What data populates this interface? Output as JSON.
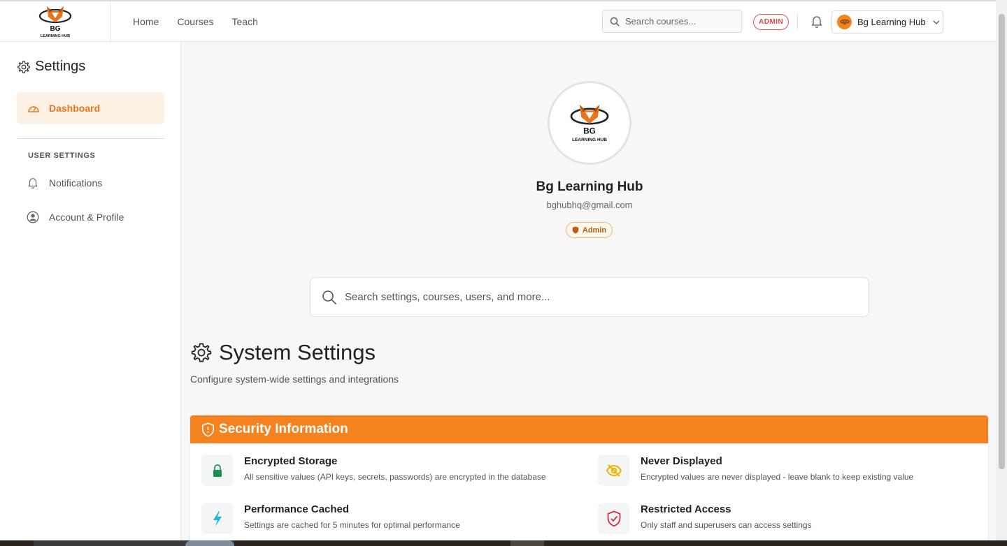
{
  "brand": {
    "logo_text_top": "BG",
    "logo_text_bottom": "LEARNING HUB"
  },
  "nav": {
    "links": [
      "Home",
      "Courses",
      "Teach"
    ]
  },
  "header": {
    "search_placeholder": "Search courses...",
    "admin_badge": "ADMIN",
    "user_name": "Bg Learning Hub"
  },
  "sidebar": {
    "title": "Settings",
    "active_item": "Dashboard",
    "section_label": "USER SETTINGS",
    "items": [
      "Notifications",
      "Account & Profile"
    ]
  },
  "profile": {
    "name": "Bg Learning Hub",
    "email": "bghubhq@gmail.com",
    "role": "Admin"
  },
  "main_search": {
    "placeholder": "Search settings, courses, users, and more..."
  },
  "system": {
    "title": "System Settings",
    "subtitle": "Configure system-wide settings and integrations"
  },
  "security": {
    "header": "Security Information",
    "features": [
      {
        "title": "Encrypted Storage",
        "desc": "All sensitive values (API keys, secrets, passwords) are encrypted in the database",
        "icon": "lock-icon"
      },
      {
        "title": "Never Displayed",
        "desc": "Encrypted values are never displayed - leave blank to keep existing value",
        "icon": "eye-off-icon"
      },
      {
        "title": "Performance Cached",
        "desc": "Settings are cached for 5 minutes for optimal performance",
        "icon": "lightning-icon"
      },
      {
        "title": "Restricted Access",
        "desc": "Only staff and superusers can access settings",
        "icon": "shield-check-icon"
      }
    ]
  },
  "colors": {
    "accent": "#f3821f",
    "admin_red": "#e04848",
    "lock_green": "#1f8f4e",
    "bolt_cyan": "#1fb4e6",
    "eye_yellow": "#f0b400",
    "shield_red": "#d62f3c"
  }
}
